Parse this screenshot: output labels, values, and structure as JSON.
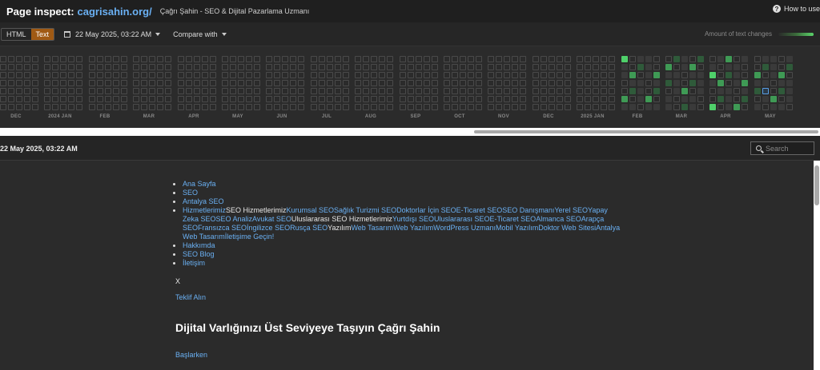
{
  "topbar": {
    "label": "Page inspect:",
    "domain": "cagrisahin.org/",
    "page_title": "Çağrı Şahin - SEO & Dijital Pazarlama Uzmanı",
    "help": "How to use"
  },
  "controls": {
    "view_html": "HTML",
    "view_text": "Text",
    "date": "22 May 2025, 03:22 AM",
    "compare": "Compare with",
    "amount_label": "Amount of text changes"
  },
  "timeline": {
    "months": [
      "DEC",
      "2024 JAN",
      "FEB",
      "MAR",
      "APR",
      "MAY",
      "JUN",
      "JUL",
      "AUG",
      "SEP",
      "OCT",
      "NOV",
      "DEC",
      "2025 JAN",
      "FEB",
      "MAR",
      "APR",
      "MAY"
    ]
  },
  "result": {
    "date": "22 May 2025, 03:22 AM",
    "search_placeholder": "Search"
  },
  "content": {
    "menu": {
      "home": "Ana Sayfa",
      "seo": "SEO",
      "antalya": "Antalya SEO",
      "services_links": [
        {
          "t": "Hizmetlerimiz",
          "link": true
        },
        {
          "t": "SEO Hizmetlerimiz",
          "link": false
        },
        {
          "t": "Kurumsal SEO",
          "link": true
        },
        {
          "t": "Sağlık Turizmi SEO",
          "link": true
        },
        {
          "t": "Doktorlar İçin SEO",
          "link": true
        },
        {
          "t": "E-Ticaret SEO",
          "link": true
        },
        {
          "t": "SEO Danışmanı",
          "link": true
        },
        {
          "t": "Yerel SEO",
          "link": true
        },
        {
          "t": "Yapay Zeka SEO",
          "link": true
        },
        {
          "t": "SEO Analiz",
          "link": true
        },
        {
          "t": "Avukat SEO",
          "link": true
        },
        {
          "t": "Uluslararası SEO Hizmetlerimiz",
          "link": false
        },
        {
          "t": "Yurtdışı SEO",
          "link": true
        },
        {
          "t": "Uluslararası SEO",
          "link": true
        },
        {
          "t": "E-Ticaret SEO",
          "link": true
        },
        {
          "t": "Almanca SEO",
          "link": true
        },
        {
          "t": "Arapça SEO",
          "link": true
        },
        {
          "t": "Fransızca SEO",
          "link": true
        },
        {
          "t": "İngilizce SEO",
          "link": true
        },
        {
          "t": "Rusça SEO",
          "link": true
        },
        {
          "t": "Yazılım",
          "link": false
        },
        {
          "t": "Web Tasarım",
          "link": true
        },
        {
          "t": "Web Yazılım",
          "link": true
        },
        {
          "t": "WordPress Uzmanı",
          "link": true
        },
        {
          "t": "Mobil Yazılım",
          "link": true
        },
        {
          "t": "Doktor Web Sitesi",
          "link": true
        },
        {
          "t": "Antalya Web Tasarım",
          "link": true
        },
        {
          "t": "İletişime Geçin!",
          "link": true
        }
      ],
      "about": "Hakkımda",
      "blog": "SEO Blog",
      "contact": "İletişim"
    },
    "close": "X",
    "offer": "Teklif Alın",
    "headline": "Dijital Varlığınızı Üst Seviyeye Taşıyın Çağrı Şahin",
    "start": "Başlarken"
  }
}
